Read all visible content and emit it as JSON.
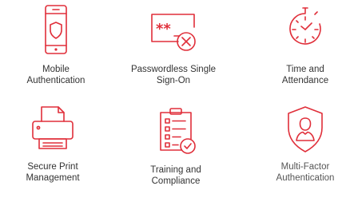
{
  "tiles": [
    {
      "label": "Mobile\nAuthentication",
      "icon": "phone-shield-icon"
    },
    {
      "label": "Passwordless Single\nSign-On",
      "icon": "password-x-icon"
    },
    {
      "label": "Time and\nAttendance",
      "icon": "stopwatch-icon"
    },
    {
      "label": "Secure Print\nManagement",
      "icon": "printer-icon"
    },
    {
      "label": "Training and\nCompliance",
      "icon": "checklist-icon"
    },
    {
      "label": "Multi-Factor\nAuthentication",
      "icon": "shield-user-icon"
    }
  ],
  "password_glyphs": "**",
  "colors": {
    "accent": "#e02f3a",
    "text": "#333333"
  }
}
